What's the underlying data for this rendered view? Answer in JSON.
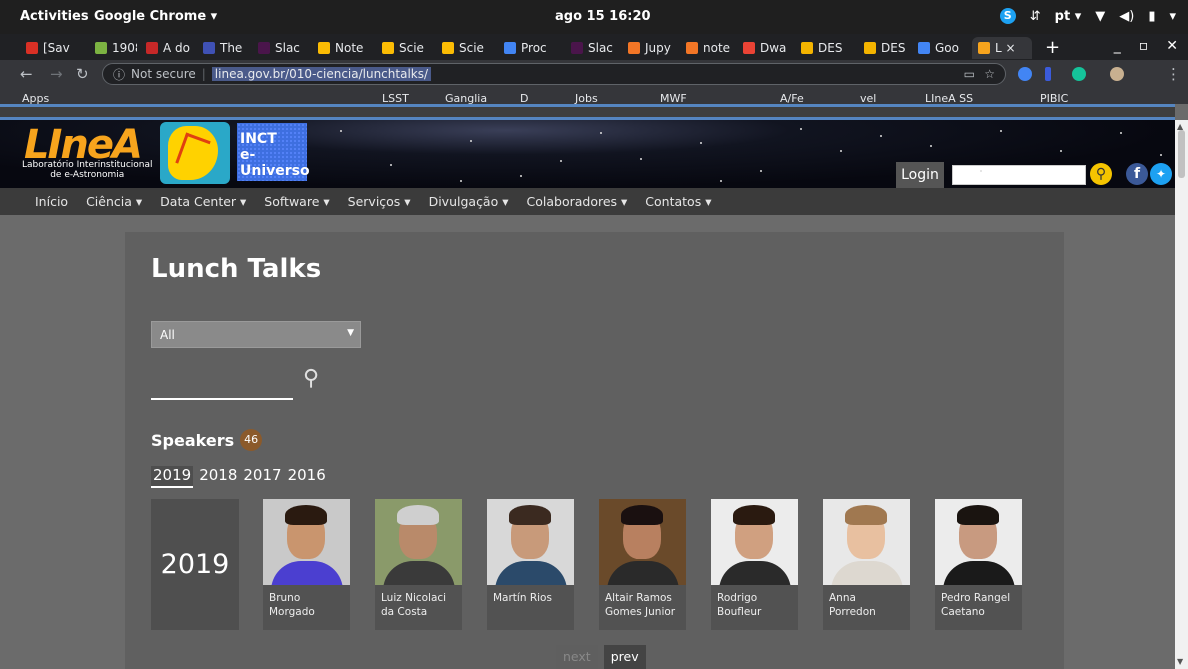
{
  "os": {
    "activities": "Activities",
    "app_name": "Google Chrome ▾",
    "clock": "ago 15  16:20",
    "language": "pt ▾"
  },
  "tabs": [
    {
      "label": "[Sav",
      "color": "#d93025"
    },
    {
      "label": "1908",
      "color": "#7cb342"
    },
    {
      "label": "A do",
      "color": "#c62828"
    },
    {
      "label": "The",
      "color": "#3f51b5"
    },
    {
      "label": "Slac",
      "color": "#4a154b"
    },
    {
      "label": "Note",
      "color": "#fbbc04"
    },
    {
      "label": "Scie",
      "color": "#fbbc04"
    },
    {
      "label": "Scie",
      "color": "#fbbc04"
    },
    {
      "label": "Proc",
      "color": "#4285f4"
    },
    {
      "label": "Slac",
      "color": "#4a154b"
    },
    {
      "label": "Jupy",
      "color": "#f37626"
    },
    {
      "label": "note",
      "color": "#f37626"
    },
    {
      "label": "Dwa",
      "color": "#ea4335"
    },
    {
      "label": "DES",
      "color": "#f4b400"
    },
    {
      "label": "DES",
      "color": "#f4b400"
    },
    {
      "label": "Goo",
      "color": "#4285f4"
    },
    {
      "label": "L ×",
      "color": "#f7a41d"
    }
  ],
  "address": {
    "security": "Not secure",
    "url": "linea.gov.br/010-ciencia/lunchtalks/"
  },
  "bookmarks": [
    "Apps",
    "LSST",
    "Ganglia",
    "D",
    "Jobs",
    "MWF",
    "A/Fe",
    "vel",
    "LIneA SS",
    "PIBIC"
  ],
  "site": {
    "logo": "LIneA",
    "logo_sub_1": "Laboratório Interinstitucional",
    "logo_sub_2": "de e-Astronomia",
    "inct_1": "INCT",
    "inct_2": "e-Universo",
    "login_label": "Login",
    "nav": [
      "Início",
      "Ciência ▾",
      "Data Center ▾",
      "Software ▾",
      "Serviços ▾",
      "Divulgação ▾",
      "Colaboradores ▾",
      "Contatos ▾"
    ]
  },
  "main": {
    "title": "Lunch Talks",
    "filter_value": "All",
    "speakers_label": "Speakers",
    "speakers_count": "46",
    "years": [
      "2019",
      "2018",
      "2017",
      "2016"
    ],
    "year_block": "2019",
    "speakers": [
      {
        "name": "Bruno Morgado",
        "bg": "#c9c9c9",
        "skin": "#c9956e",
        "hair": "#2a1a10",
        "shirt": "#4b3fd0"
      },
      {
        "name": "Luiz Nicolaci da Costa",
        "bg": "#8a9a6a",
        "skin": "#b98a6a",
        "hair": "#cfcfcf",
        "shirt": "#3a3a3a"
      },
      {
        "name": "Martín Rios",
        "bg": "#d8d8d8",
        "skin": "#c89a7a",
        "hair": "#3b2a20",
        "shirt": "#2b4a6a"
      },
      {
        "name": "Altair Ramos Gomes Junior",
        "bg": "#6a4a2a",
        "skin": "#b88060",
        "hair": "#1a1010",
        "shirt": "#2a2a2a"
      },
      {
        "name": "Rodrigo Boufleur",
        "bg": "#ececec",
        "skin": "#d0a080",
        "hair": "#2a1a10",
        "shirt": "#2a2a2a"
      },
      {
        "name": "Anna Porredon",
        "bg": "#e8e8e8",
        "skin": "#e8c0a0",
        "hair": "#a07850",
        "shirt": "#ddd8d0"
      },
      {
        "name": "Pedro Rangel Caetano",
        "bg": "#ececec",
        "skin": "#c89a80",
        "hair": "#1a1410",
        "shirt": "#1a1a1a"
      }
    ],
    "pager_next": "next",
    "pager_prev": "prev"
  }
}
